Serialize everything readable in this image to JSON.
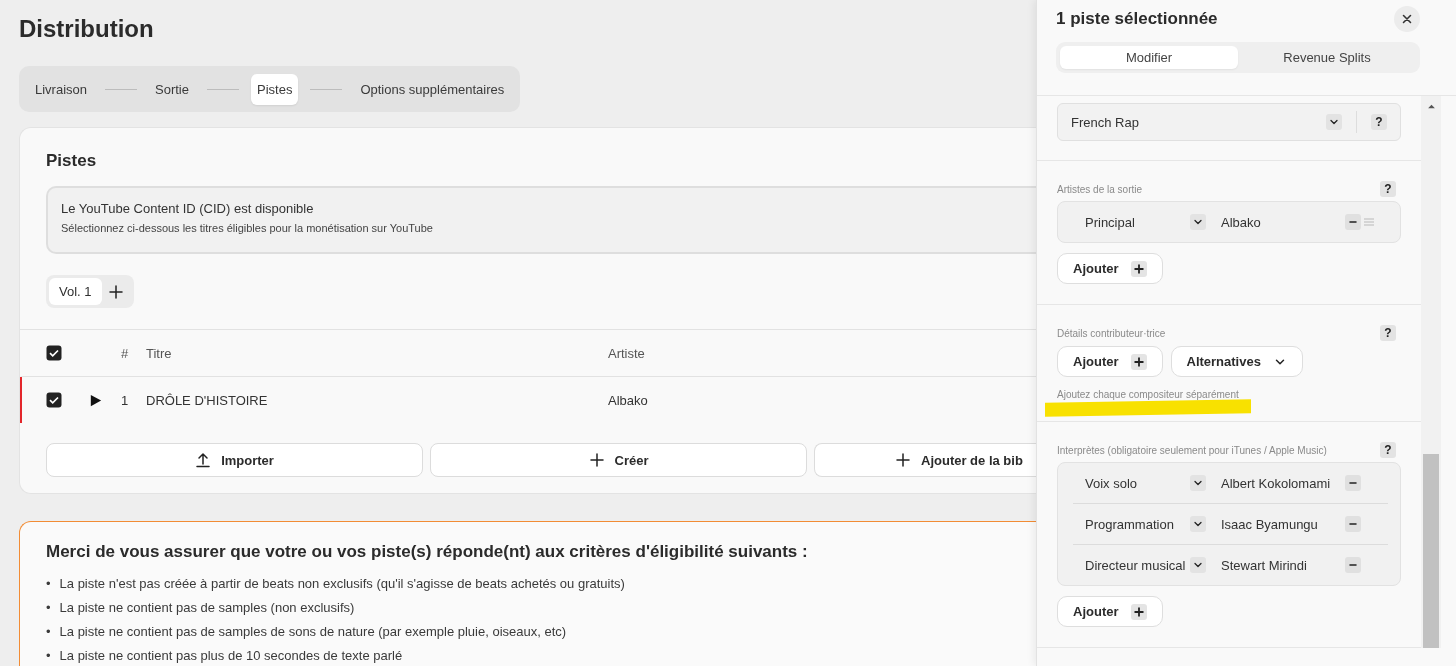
{
  "page": {
    "title": "Distribution"
  },
  "steps": [
    {
      "label": "Livraison",
      "selected": false
    },
    {
      "label": "Sortie",
      "selected": false
    },
    {
      "label": "Pistes",
      "selected": true
    },
    {
      "label": "Options supplémentaires",
      "selected": false
    }
  ],
  "tracks": {
    "title": "Pistes",
    "notice": {
      "title": "Le YouTube Content ID (CID) est disponible",
      "text": "Sélectionnez ci-dessous les titres éligibles pour la monétisation sur YouTube"
    },
    "volumes": [
      {
        "label": "Vol. 1",
        "selected": true
      }
    ],
    "table": {
      "header_checked": true,
      "columns": [
        "#",
        "Titre",
        "Artiste"
      ],
      "rows": [
        {
          "checked": true,
          "selected": true,
          "number": "1",
          "title": "DRÔLE D'HISTOIRE",
          "artist": "Albako"
        }
      ]
    },
    "actions": [
      {
        "label": "Importer",
        "kind": "upload"
      },
      {
        "label": "Créer",
        "kind": "create"
      },
      {
        "label": "Ajouter de la bib",
        "kind": "create"
      }
    ]
  },
  "criteria": {
    "title": "Merci de vous assurer que votre ou vos piste(s) réponde(nt) aux critères d'éligibilité suivants :",
    "items": [
      {
        "marker": "•",
        "text": "La piste n'est pas créée à partir de beats non exclusifs (qu'il s'agisse de beats achetés ou gratuits)"
      },
      {
        "marker": "•",
        "text": "La piste ne contient pas de samples (non exclusifs)"
      },
      {
        "marker": "•",
        "text": "La piste ne contient pas de samples de sons de nature (par exemple pluie, oiseaux, etc)"
      },
      {
        "marker": "•",
        "text": "La piste ne contient pas plus de 10 secondes de texte parlé"
      }
    ]
  },
  "panel": {
    "title": "1 piste sélectionnée",
    "tabs": [
      {
        "label": "Modifier",
        "selected": true
      },
      {
        "label": "Revenue Splits",
        "selected": false
      }
    ],
    "genre": {
      "value": "French Rap",
      "help": "?"
    },
    "release_artists": {
      "label": "Artistes de la sortie",
      "help": "?",
      "drag_handle": true,
      "rows": [
        {
          "role": "Principal",
          "name": "Albako"
        }
      ],
      "add_label": "Ajouter"
    },
    "contributors": {
      "label": "Détails contributeur·trice",
      "help": "?",
      "add_label": "Ajouter",
      "alternatives_label": "Alternatives",
      "hint": "Ajoutez chaque compositeur séparément",
      "highlighted": true
    },
    "performers": {
      "label": "Interprètes (obligatoire seulement pour iTunes / Apple Music)",
      "help": "?",
      "drag_handle": false,
      "rows": [
        {
          "role": "Voix solo",
          "name": "Albert Kokolomami"
        },
        {
          "role": "Programmation",
          "name": "Isaac Byamungu"
        },
        {
          "role": "Directeur musical",
          "name": "Stewart Mirindi"
        }
      ],
      "add_label": "Ajouter"
    }
  }
}
